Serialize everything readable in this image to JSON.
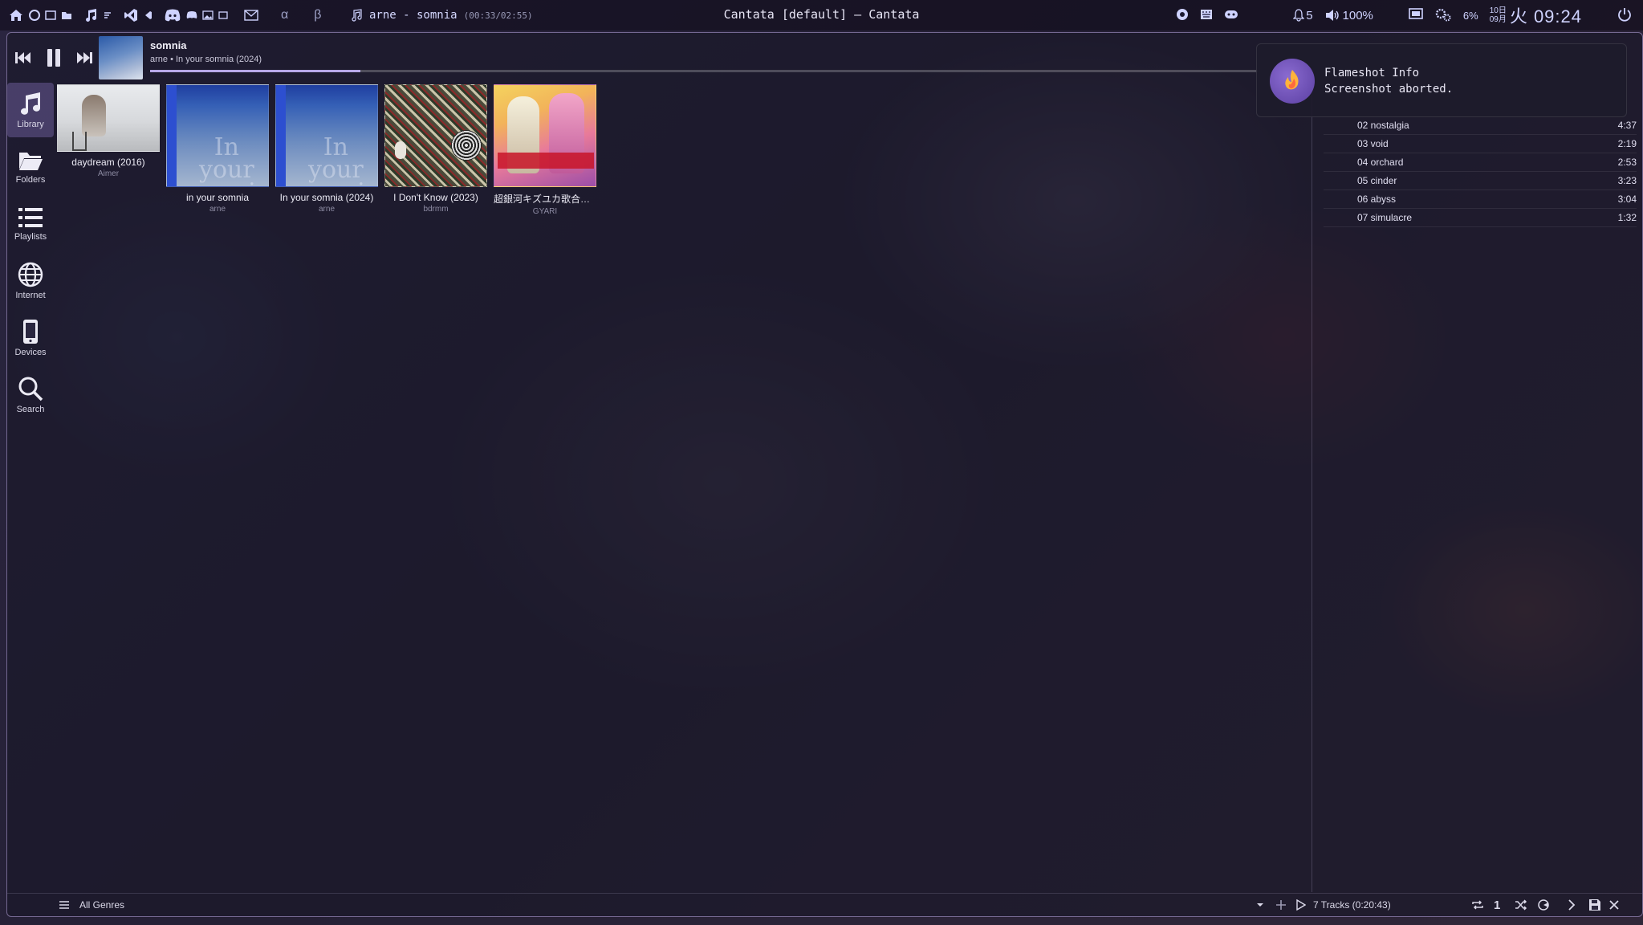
{
  "topbar": {
    "greek_alpha": "α",
    "greek_beta": "β",
    "now_playing": "arne - somnia",
    "now_playing_time": "(00:33/02:55)",
    "window_title": "Cantata [default] — Cantata",
    "notifications": "5",
    "volume": "100%",
    "cpu": "6%",
    "date_top": "10日",
    "date_bottom": "09月",
    "clock": "火 09:24"
  },
  "player": {
    "title": "somnia",
    "subtitle": "arne • In your somnia (2024)",
    "progress_fraction": 0.19
  },
  "sidebar": {
    "items": [
      {
        "label": "Library",
        "icon": "music-note-icon",
        "active": true
      },
      {
        "label": "Folders",
        "icon": "folder-icon"
      },
      {
        "label": "Playlists",
        "icon": "list-icon"
      },
      {
        "label": "Internet",
        "icon": "globe-icon"
      },
      {
        "label": "Devices",
        "icon": "phone-icon"
      },
      {
        "label": "Search",
        "icon": "search-icon"
      }
    ]
  },
  "albums": [
    {
      "title": "daydream (2016)",
      "artist": "Aimer"
    },
    {
      "title": "in your somnia",
      "artist": "arne"
    },
    {
      "title": "In your somnia (2024)",
      "artist": "arne"
    },
    {
      "title": "I Don't Know (2023)",
      "artist": "bdrmm"
    },
    {
      "title": "超銀河キズユカ歌合戦 ...",
      "artist": "GYARI"
    }
  ],
  "playlist": [
    {
      "track": "02 nostalgia",
      "duration": "4:37"
    },
    {
      "track": "03 void",
      "duration": "2:19"
    },
    {
      "track": "04 orchard",
      "duration": "2:53"
    },
    {
      "track": "05 cinder",
      "duration": "3:23"
    },
    {
      "track": "06 abyss",
      "duration": "3:04"
    },
    {
      "track": "07 simulacre",
      "duration": "1:32"
    }
  ],
  "statusbar": {
    "genre": "All Genres",
    "tracks": "7 Tracks (0:20:43)",
    "single": "1"
  },
  "toast": {
    "title": "Flameshot Info",
    "body": "Screenshot aborted."
  },
  "colors": {
    "accent": "#b8a8e8",
    "topbar_text": "#cfd3ff"
  }
}
